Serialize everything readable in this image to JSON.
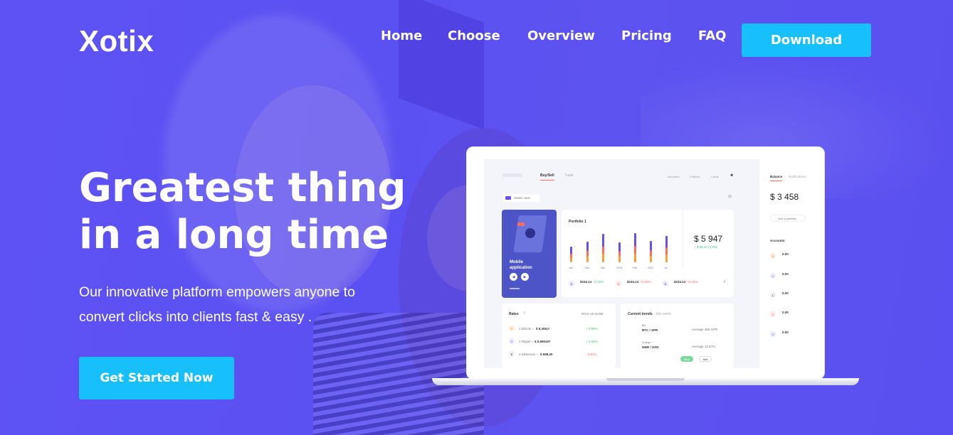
{
  "brand": {
    "logo": "Xotix"
  },
  "nav": {
    "items": [
      {
        "label": "Home"
      },
      {
        "label": "Choose"
      },
      {
        "label": "Overview"
      },
      {
        "label": "Pricing"
      },
      {
        "label": "FAQ"
      }
    ],
    "download_label": "Download"
  },
  "hero": {
    "title_line1": "Greatest thing",
    "title_line2": "in a long time",
    "subtitle_line1": "Our innovative platform empowers anyone to",
    "subtitle_line2": "convert clicks into clients fast & easy .",
    "cta_label": "Get Started Now"
  },
  "colors": {
    "background": "#5a4ff0",
    "accent": "#17c0fb",
    "bar_purple": "#6c4fe8",
    "bar_red": "#ff6b5c",
    "bar_orange": "#f7a035"
  },
  "dashboard": {
    "tabs": [
      "Buy/Sell",
      "Trade"
    ],
    "menu": [
      "Accounts",
      "Portfolio",
      "Cards"
    ],
    "select_card": "Select card",
    "promo": {
      "title_line1": "Mobile",
      "title_line2": "application"
    },
    "portfolio": {
      "title": "Portfolio 1",
      "value": "$ 5 947",
      "change": "+ $ 69,20 (3,3%)",
      "months": [
        "Jan",
        "Dec",
        "Mar",
        "2018",
        "Feb",
        "2022",
        "Jul"
      ]
    },
    "portfolio_items": [
      {
        "value": "$234.14",
        "change": "+2,42%"
      },
      {
        "value": "$234.14",
        "change": "+2,62%"
      },
      {
        "value": "$234.14",
        "change": "+0,42%"
      }
    ],
    "rates": {
      "title": "Rates",
      "price_label": "Price US Dollar",
      "rows": [
        {
          "name": "1 Bitcoin =",
          "value": "$ 8,308,0",
          "change": "+ 3.58%"
        },
        {
          "name": "1 Ripple =",
          "value": "$ 0,695167",
          "change": "+ 3.58%"
        },
        {
          "name": "1 Ethereum =",
          "value": "$ 698,30",
          "change": "- 3.81%"
        }
      ]
    },
    "trends": {
      "title": "Current trends",
      "title_suffix": "this week",
      "rows": [
        {
          "label": "Bid",
          "pair": "BTC / XPR",
          "average": "Average 360 XPR"
        },
        {
          "label": "Change",
          "pair": "MNR / USD",
          "average": "Average 12 ETH"
        }
      ],
      "buy": "Buy",
      "sell": "Sell"
    },
    "balance": {
      "tabs": [
        "Balance",
        "Notifications"
      ],
      "value": "$ 3 458",
      "add_portfolio": "Add a portfolio",
      "accounts_label": "Accounts",
      "accounts": [
        {
          "symbol": "B",
          "value": "0.00"
        },
        {
          "symbol": "X",
          "value": "0.00"
        },
        {
          "symbol": "L",
          "value": "0.00"
        },
        {
          "symbol": "Z",
          "value": "0.00"
        },
        {
          "symbol": "G",
          "value": "0.00"
        }
      ]
    }
  }
}
